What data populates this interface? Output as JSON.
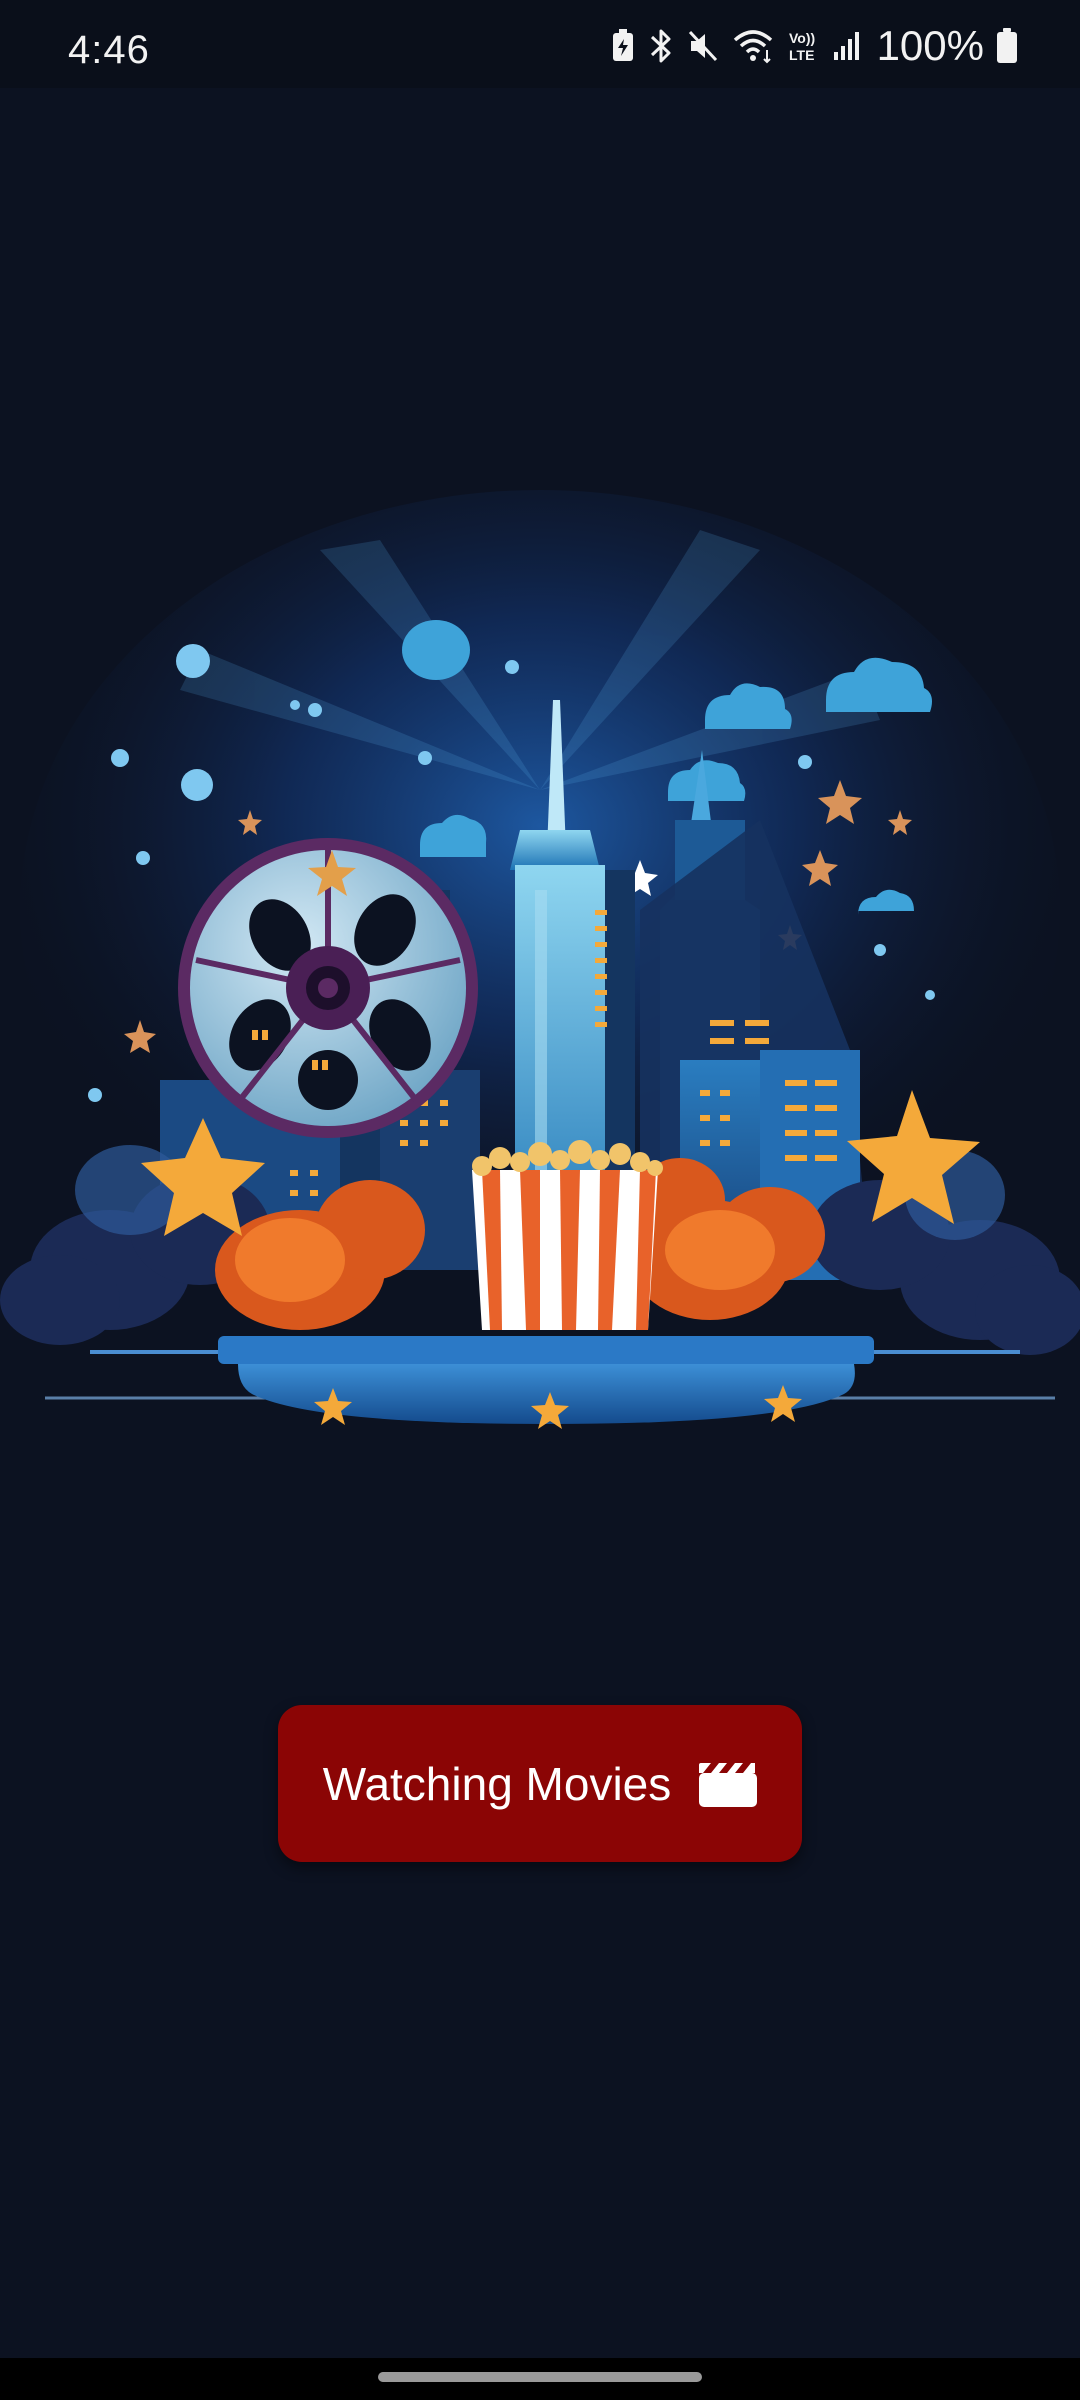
{
  "status_bar": {
    "time": "4:46",
    "battery_percent": "100%",
    "icons": [
      "battery-saver-icon",
      "bluetooth-icon",
      "mute-icon",
      "wifi-icon",
      "volte-icon",
      "signal-icon",
      "battery-icon"
    ]
  },
  "hero": {
    "illustration": "cinema-city-illustration"
  },
  "cta": {
    "label": "Watching Movies",
    "icon": "clapperboard-icon",
    "color": "#8b0505"
  },
  "colors": {
    "background": "#0c1221",
    "accent": "#8b0505"
  }
}
